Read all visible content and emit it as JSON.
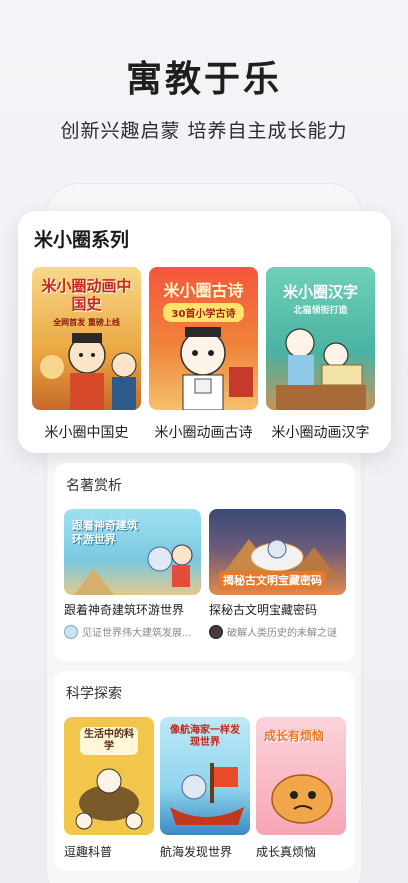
{
  "hero": {
    "title": "寓教于乐",
    "subtitle": "创新兴趣启蒙  培养自主成长能力"
  },
  "series": {
    "title": "米小圈系列",
    "items": [
      {
        "label": "米小圈中国史",
        "cover_text": "米小圈动画中国史",
        "cover_tag": "全网首发 重磅上线",
        "color": "#f3b440"
      },
      {
        "label": "米小圈动画古诗",
        "cover_text": "米小圈古诗",
        "cover_tag": "30首小学古诗",
        "color": "#f25a3a"
      },
      {
        "label": "米小圈动画汉字",
        "cover_text": "米小圈汉字",
        "cover_tag": "北猫领衔打造",
        "color": "#5fc2b0"
      }
    ]
  },
  "classics": {
    "title": "名著赏析",
    "items": [
      {
        "title": "跟着神奇建筑环游世界",
        "desc": "见证世界伟大建筑发展...",
        "cover_text": "跟着神奇建筑环游世界",
        "color": "#7fd0e6"
      },
      {
        "title": "探秘古文明宝藏密码",
        "desc": "破解人类历史的未解之谜",
        "cover_text": "揭秘古文明宝藏密码",
        "color": "#2f3b5e"
      }
    ]
  },
  "science": {
    "title": "科学探索",
    "items": [
      {
        "title": "逗趣科普",
        "cover_text": "生活中的科学",
        "color": "#f2c64a"
      },
      {
        "title": "航海发现世界",
        "cover_text": "像航海家一样发现世界",
        "color": "#8fd4ee"
      },
      {
        "title": "成长真烦恼",
        "cover_text": "成长有烦恼",
        "color": "#f7a6b5"
      }
    ]
  }
}
